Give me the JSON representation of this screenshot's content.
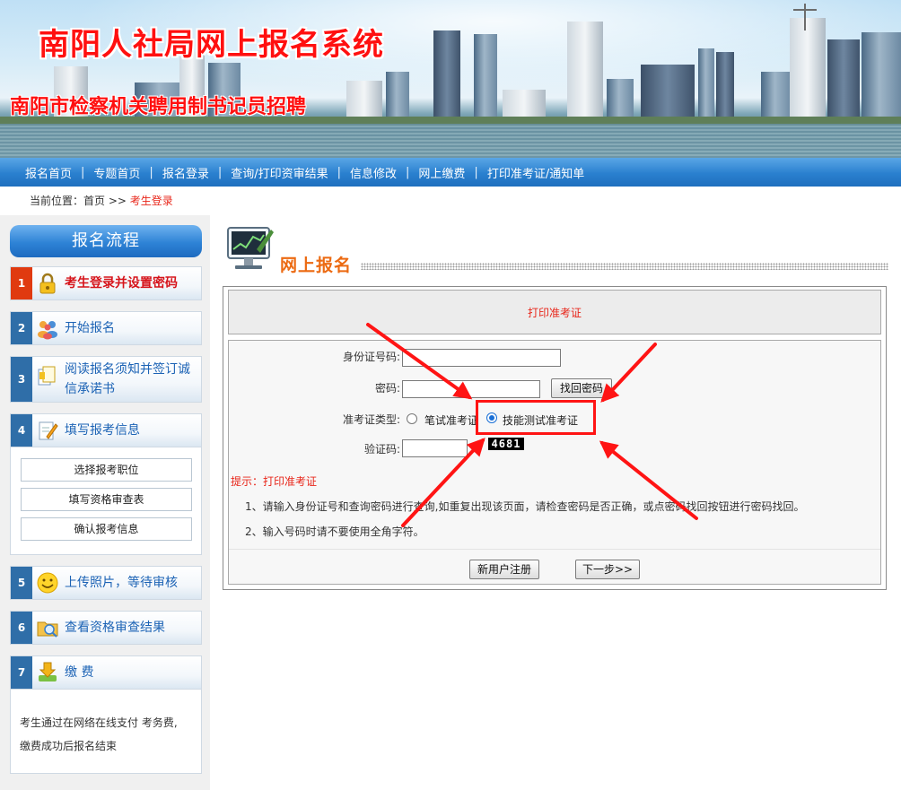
{
  "banner": {
    "title": "南阳人社局网上报名系统",
    "subtitle": "南阳市检察机关聘用制书记员招聘"
  },
  "nav": {
    "items": [
      "报名首页",
      "专题首页",
      "报名登录",
      "查询/打印资审结果",
      "信息修改",
      "网上缴费",
      "打印准考证/通知单"
    ],
    "separator": "|"
  },
  "breadcrumb": {
    "prefix": "当前位置：",
    "home": "首页",
    "arrow": ">>",
    "current": "考生登录"
  },
  "sidebar": {
    "title": "报名流程",
    "steps": [
      {
        "num": "1",
        "label": "考生登录并设置密码",
        "icon": "lock-icon",
        "active": true
      },
      {
        "num": "2",
        "label": "开始报名",
        "icon": "people-icon"
      },
      {
        "num": "3",
        "label": "阅读报名须知并签订诚信承诺书",
        "icon": "document-icon"
      },
      {
        "num": "4",
        "label": "填写报考信息",
        "icon": "pen-paper-icon"
      },
      {
        "num": "5",
        "label": "上传照片，等待审核",
        "icon": "smiley-icon"
      },
      {
        "num": "6",
        "label": "查看资格审查结果",
        "icon": "folder-icon"
      },
      {
        "num": "7",
        "label": "缴 费",
        "icon": "download-arrow-icon"
      }
    ],
    "step4_subitems": [
      "选择报考职位",
      "填写资格审查表",
      "确认报考信息"
    ],
    "step7_note_line1": "考生通过在网络在线支付 考务费,",
    "step7_note_line2": "缴费成功后报名结束"
  },
  "main": {
    "section_title": "网上报名",
    "panel_header": "打印准考证",
    "form": {
      "id_label": "身份证号码:",
      "id_value": "",
      "password_label": "密码:",
      "password_value": "",
      "find_password_button": "找回密码",
      "type_label": "准考证类型:",
      "type_options": [
        "笔试准考证",
        "技能测试准考证"
      ],
      "type_selected": "技能测试准考证",
      "captcha_label": "验证码:",
      "captcha_value": "",
      "captcha_code": "4681"
    },
    "tip_label": "提示：打印准考证",
    "tips": [
      "1、请输入身份证号和查询密码进行查询,如重复出现该页面，请检查密码是否正确，或点密码找回按钮进行密码找回。",
      "2、输入号码时请不要使用全角字符。"
    ],
    "register_button": "新用户注册",
    "next_button": "下一步>>"
  },
  "annotation": {
    "highlight_color": "#ff1414"
  }
}
